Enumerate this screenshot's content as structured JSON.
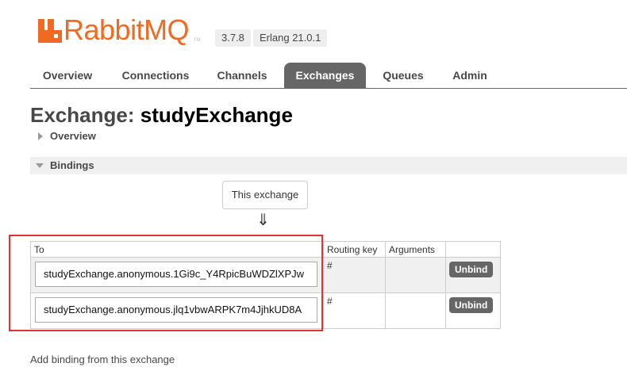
{
  "brand": {
    "name": "RabbitMQ",
    "trademark": "TM",
    "color": "#f26a21"
  },
  "versions": {
    "rabbitmq": "3.7.8",
    "erlang": "Erlang 21.0.1"
  },
  "tabs": [
    {
      "label": "Overview",
      "active": false
    },
    {
      "label": "Connections",
      "active": false
    },
    {
      "label": "Channels",
      "active": false
    },
    {
      "label": "Exchanges",
      "active": true
    },
    {
      "label": "Queues",
      "active": false
    },
    {
      "label": "Admin",
      "active": false
    }
  ],
  "page": {
    "title_prefix": "Exchange:",
    "exchange_name": "studyExchange"
  },
  "sections": {
    "overview": "Overview",
    "bindings": "Bindings"
  },
  "bindings": {
    "source_label": "This exchange",
    "arrow": "⇓",
    "headers": {
      "to": "To",
      "routing_key": "Routing key",
      "arguments": "Arguments"
    },
    "rows": [
      {
        "to": "studyExchange.anonymous.1Gi9c_Y4RpicBuWDZlXPJw",
        "routing_key": "#",
        "arguments": "",
        "action": "Unbind"
      },
      {
        "to": "studyExchange.anonymous.jlq1vbwARPK7m4JjhkUD8A",
        "routing_key": "#",
        "arguments": "",
        "action": "Unbind"
      }
    ]
  },
  "footer": {
    "add_binding": "Add binding from this exchange"
  },
  "colors": {
    "highlight": "#e03434",
    "tab_active": "#666666",
    "button": "#666666"
  }
}
